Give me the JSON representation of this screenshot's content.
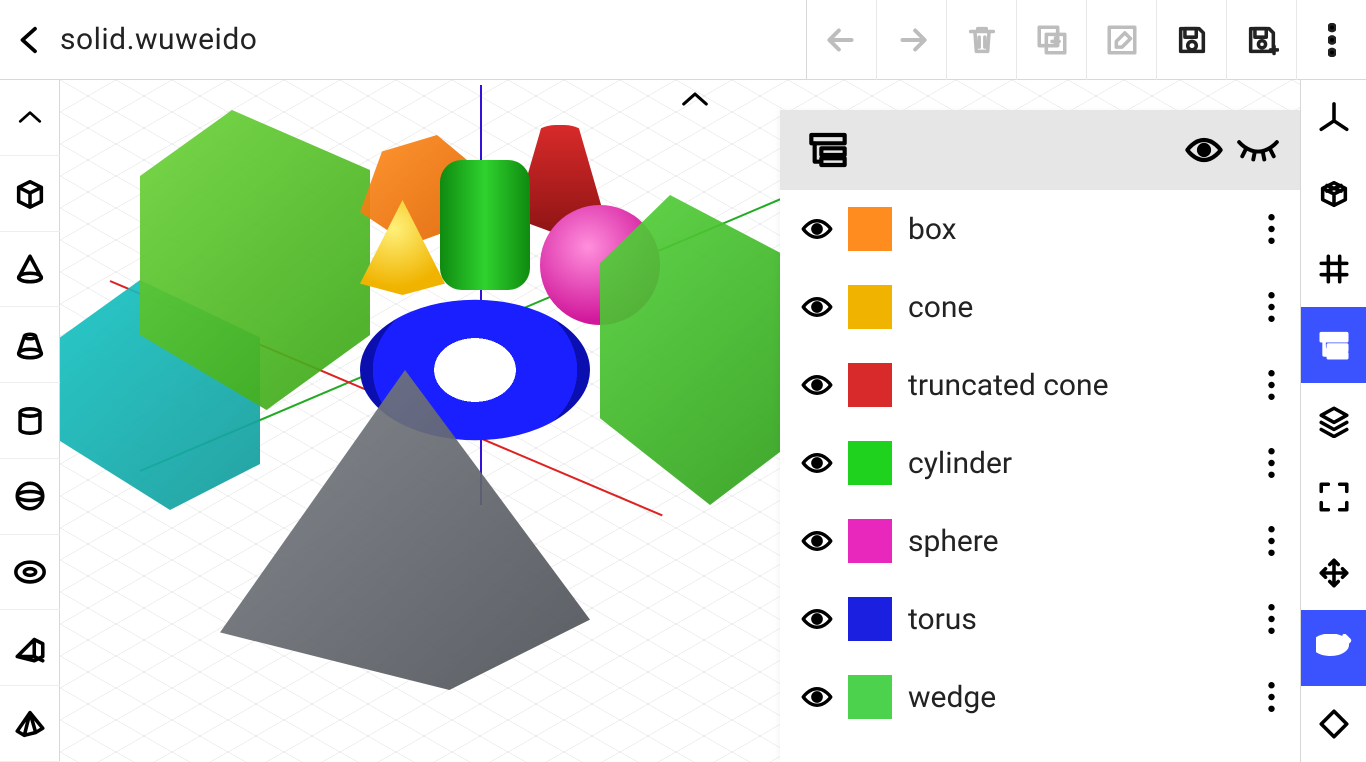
{
  "header": {
    "filename": "solid.wuweido"
  },
  "toolbar_top": {
    "back": "back",
    "undo": "undo",
    "redo": "redo",
    "delete": "delete",
    "duplicate": "duplicate",
    "edit": "edit",
    "save": "save",
    "save_as": "save-as",
    "more": "more"
  },
  "left_tools": [
    {
      "name": "collapse-up-icon"
    },
    {
      "name": "box-tool"
    },
    {
      "name": "cone-tool"
    },
    {
      "name": "truncated-cone-tool"
    },
    {
      "name": "cylinder-tool"
    },
    {
      "name": "sphere-tool"
    },
    {
      "name": "torus-tool"
    },
    {
      "name": "wedge-tool"
    },
    {
      "name": "pyramid-tool"
    }
  ],
  "right_tools": [
    {
      "name": "axes-view",
      "active": false
    },
    {
      "name": "wireframe-view",
      "active": false
    },
    {
      "name": "grid-toggle",
      "active": false
    },
    {
      "name": "scene-tree",
      "active": true
    },
    {
      "name": "layers",
      "active": false
    },
    {
      "name": "fit-view",
      "active": false
    },
    {
      "name": "move-tool",
      "active": false
    },
    {
      "name": "orbit-tool",
      "active": true
    },
    {
      "name": "rotate-tool",
      "active": false
    }
  ],
  "scene_tree": {
    "header_icons": {
      "tree": "tree-icon",
      "show": "eye-open-icon",
      "hide": "eye-closed-icon"
    },
    "items": [
      {
        "label": "box",
        "color": "#ff8c1e",
        "visible": true
      },
      {
        "label": "cone",
        "color": "#f0b400",
        "visible": true
      },
      {
        "label": "truncated cone",
        "color": "#d82a2a",
        "visible": true
      },
      {
        "label": "cylinder",
        "color": "#1ed21e",
        "visible": true
      },
      {
        "label": "sphere",
        "color": "#e828bd",
        "visible": true
      },
      {
        "label": "torus",
        "color": "#1b1fe0",
        "visible": true
      },
      {
        "label": "wedge",
        "color": "#4cd24c",
        "visible": true
      }
    ]
  },
  "colors": {
    "accent": "#3a53ff",
    "axis_x": "#d22",
    "axis_y": "#31d",
    "axis_z": "#2a2"
  }
}
